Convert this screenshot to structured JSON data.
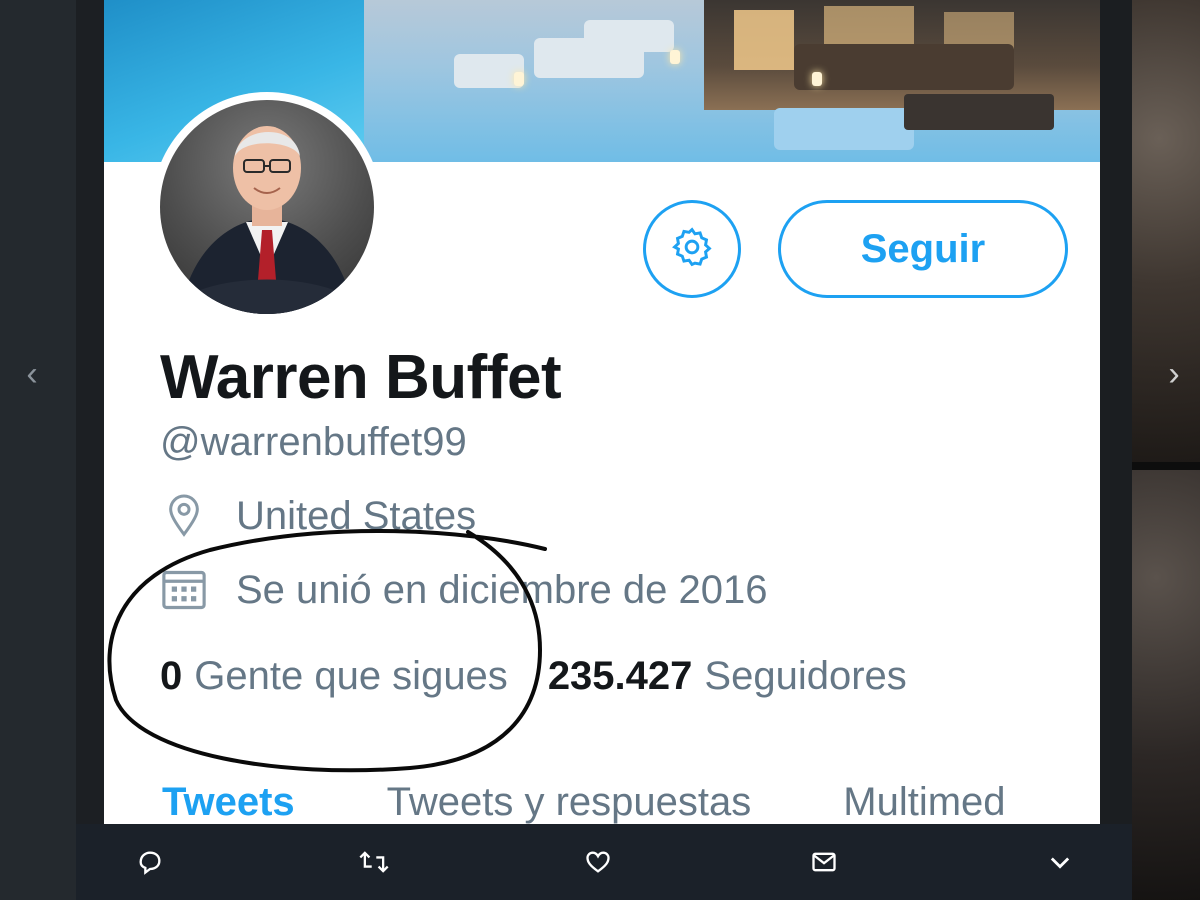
{
  "profile": {
    "name": "Warren Buffet",
    "handle": "@warrenbuffet99",
    "location": "United States",
    "joined": "Se unió en diciembre de 2016",
    "follow_label": "Seguir",
    "settings_icon": "gear-icon"
  },
  "stats": {
    "following_count": "0",
    "following_label": "Gente que sigues",
    "followers_count": "235.427",
    "followers_label": "Seguidores"
  },
  "tabs": [
    "Tweets",
    "Tweets y respuestas",
    "Multimed"
  ],
  "active_tab": "Tweets",
  "lightbox": {
    "prev_icon": "chevron-left-icon",
    "next_icon": "chevron-right-icon"
  },
  "action_bar": {
    "icons": [
      "reply-icon",
      "retweet-icon",
      "like-icon",
      "message-icon",
      "chevron-down-icon"
    ]
  },
  "colors": {
    "accent": "#1da1f2",
    "text_primary": "#14171a",
    "text_secondary": "#657786",
    "annotation": "#0a0a0a"
  }
}
